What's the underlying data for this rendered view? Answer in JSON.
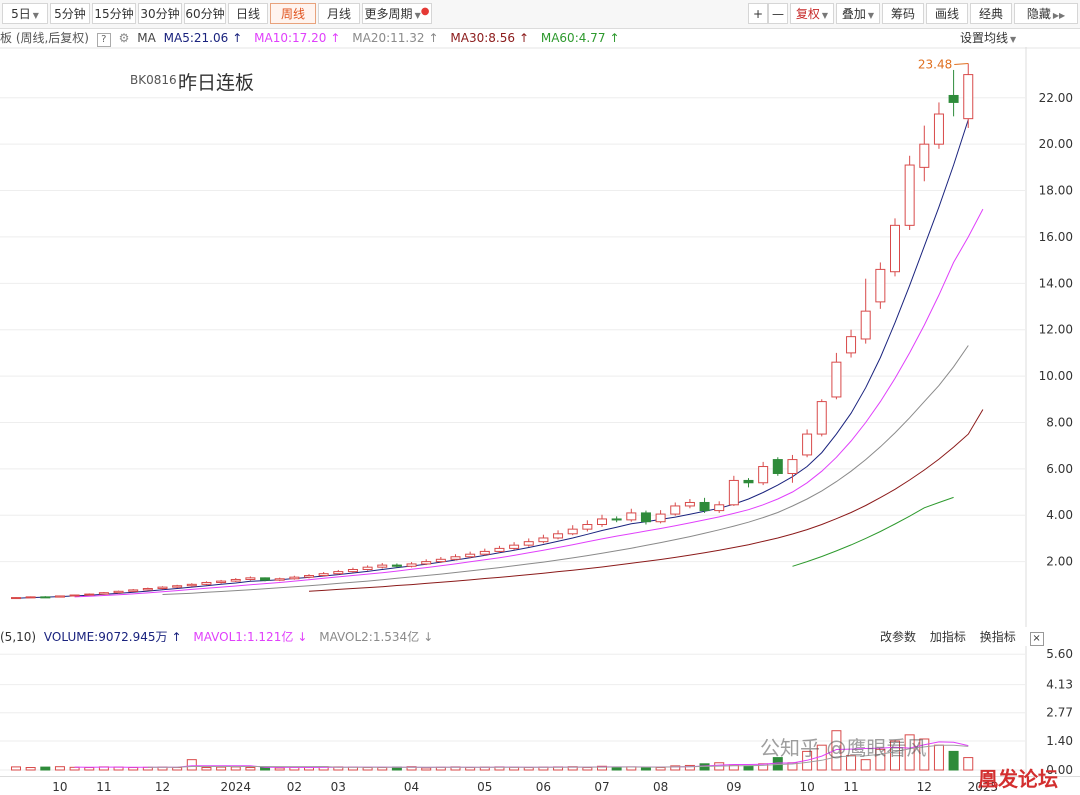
{
  "toolbar": {
    "periods": [
      "5日",
      "5分钟",
      "15分钟",
      "30分钟",
      "60分钟",
      "日线",
      "周线",
      "月线",
      "更多周期"
    ],
    "active_period": "周线",
    "plus": "+",
    "minus": "—",
    "fuquan": "复权",
    "overlay": "叠加",
    "chips": "筹码",
    "draw": "画线",
    "classic": "经典",
    "hide": "隐藏"
  },
  "ma_legend": {
    "prefix": "板 (周线,后复权)",
    "help": "?",
    "ma_label": "MA",
    "items": [
      {
        "text": "MA5:21.06",
        "arrow": "↑",
        "color": "#1a237e"
      },
      {
        "text": "MA10:17.20",
        "arrow": "↑",
        "color": "#e040fb"
      },
      {
        "text": "MA20:11.32",
        "arrow": "↑",
        "color": "#8a8a8a"
      },
      {
        "text": "MA30:8.56",
        "arrow": "↑",
        "color": "#8b1a1a"
      },
      {
        "text": "MA60:4.77",
        "arrow": "↑",
        "color": "#2e9a2e"
      }
    ],
    "settings": "设置均线"
  },
  "chart_title": {
    "code": "BK0816",
    "name": "昨日连板"
  },
  "volume_legend": {
    "prefix": "(5,10)",
    "volume": "VOLUME:9072.945万",
    "volume_arrow": "↑",
    "mavol1": "MAVOL1:1.121亿",
    "mavol1_arrow": "↓",
    "mavol2": "MAVOL2:1.534亿",
    "mavol2_arrow": "↓",
    "tools": [
      "改参数",
      "加指标",
      "换指标"
    ],
    "close": "×"
  },
  "watermark": {
    "text1": "公知乎 @鹰眼看风",
    "text2": "凰发论坛"
  },
  "chart_data": {
    "type": "candlestick",
    "period": "weekly",
    "max_label": "23.48",
    "price_axis": {
      "ticks": [
        2.0,
        4.0,
        6.0,
        8.0,
        10.0,
        12.0,
        14.0,
        16.0,
        18.0,
        20.0,
        22.0
      ],
      "ylim": [
        0,
        23.5
      ]
    },
    "volume_axis": {
      "ticks": [
        "5.60",
        "4.13",
        "2.77",
        "1.40",
        "0.00"
      ],
      "ylim": [
        0,
        5.9
      ]
    },
    "time_labels": [
      "10",
      "11",
      "12",
      "2024",
      "02",
      "03",
      "04",
      "05",
      "06",
      "07",
      "08",
      "09",
      "10",
      "11",
      "12",
      "2025"
    ],
    "colors": {
      "up": "#d84a4a",
      "down": "#2e8b3a"
    },
    "candles": [
      {
        "o": 0.42,
        "c": 0.45,
        "h": 0.47,
        "l": 0.4
      },
      {
        "o": 0.45,
        "c": 0.48,
        "h": 0.5,
        "l": 0.43
      },
      {
        "o": 0.48,
        "c": 0.47,
        "h": 0.51,
        "l": 0.45
      },
      {
        "o": 0.47,
        "c": 0.52,
        "h": 0.54,
        "l": 0.46
      },
      {
        "o": 0.52,
        "c": 0.56,
        "h": 0.58,
        "l": 0.5
      },
      {
        "o": 0.56,
        "c": 0.6,
        "h": 0.63,
        "l": 0.54
      },
      {
        "o": 0.6,
        "c": 0.66,
        "h": 0.69,
        "l": 0.58
      },
      {
        "o": 0.66,
        "c": 0.72,
        "h": 0.75,
        "l": 0.63
      },
      {
        "o": 0.72,
        "c": 0.78,
        "h": 0.82,
        "l": 0.7
      },
      {
        "o": 0.78,
        "c": 0.84,
        "h": 0.88,
        "l": 0.75
      },
      {
        "o": 0.84,
        "c": 0.9,
        "h": 0.94,
        "l": 0.8
      },
      {
        "o": 0.9,
        "c": 0.96,
        "h": 1.0,
        "l": 0.86
      },
      {
        "o": 0.96,
        "c": 1.02,
        "h": 1.07,
        "l": 0.92
      },
      {
        "o": 1.02,
        "c": 1.1,
        "h": 1.15,
        "l": 0.98
      },
      {
        "o": 1.1,
        "c": 1.16,
        "h": 1.21,
        "l": 1.05
      },
      {
        "o": 1.16,
        "c": 1.23,
        "h": 1.29,
        "l": 1.12
      },
      {
        "o": 1.23,
        "c": 1.3,
        "h": 1.36,
        "l": 1.18
      },
      {
        "o": 1.3,
        "c": 1.2,
        "h": 1.32,
        "l": 1.15
      },
      {
        "o": 1.2,
        "c": 1.26,
        "h": 1.31,
        "l": 1.16
      },
      {
        "o": 1.26,
        "c": 1.33,
        "h": 1.39,
        "l": 1.22
      },
      {
        "o": 1.33,
        "c": 1.4,
        "h": 1.46,
        "l": 1.28
      },
      {
        "o": 1.4,
        "c": 1.48,
        "h": 1.55,
        "l": 1.35
      },
      {
        "o": 1.48,
        "c": 1.57,
        "h": 1.64,
        "l": 1.44
      },
      {
        "o": 1.57,
        "c": 1.66,
        "h": 1.74,
        "l": 1.52
      },
      {
        "o": 1.66,
        "c": 1.76,
        "h": 1.84,
        "l": 1.61
      },
      {
        "o": 1.76,
        "c": 1.85,
        "h": 1.94,
        "l": 1.7
      },
      {
        "o": 1.85,
        "c": 1.8,
        "h": 1.92,
        "l": 1.74
      },
      {
        "o": 1.8,
        "c": 1.9,
        "h": 1.98,
        "l": 1.75
      },
      {
        "o": 1.9,
        "c": 2.0,
        "h": 2.1,
        "l": 1.85
      },
      {
        "o": 2.0,
        "c": 2.1,
        "h": 2.2,
        "l": 1.94
      },
      {
        "o": 2.1,
        "c": 2.21,
        "h": 2.32,
        "l": 2.05
      },
      {
        "o": 2.21,
        "c": 2.32,
        "h": 2.43,
        "l": 2.15
      },
      {
        "o": 2.32,
        "c": 2.44,
        "h": 2.56,
        "l": 2.26
      },
      {
        "o": 2.44,
        "c": 2.57,
        "h": 2.68,
        "l": 2.38
      },
      {
        "o": 2.57,
        "c": 2.71,
        "h": 2.84,
        "l": 2.5
      },
      {
        "o": 2.71,
        "c": 2.86,
        "h": 3.0,
        "l": 2.64
      },
      {
        "o": 2.86,
        "c": 3.02,
        "h": 3.16,
        "l": 2.79
      },
      {
        "o": 3.02,
        "c": 3.2,
        "h": 3.35,
        "l": 2.96
      },
      {
        "o": 3.2,
        "c": 3.4,
        "h": 3.57,
        "l": 3.14
      },
      {
        "o": 3.4,
        "c": 3.6,
        "h": 3.78,
        "l": 3.3
      },
      {
        "o": 3.6,
        "c": 3.84,
        "h": 4.02,
        "l": 3.5
      },
      {
        "o": 3.84,
        "c": 3.8,
        "h": 3.95,
        "l": 3.7
      },
      {
        "o": 3.8,
        "c": 4.1,
        "h": 4.28,
        "l": 3.72
      },
      {
        "o": 4.1,
        "c": 3.72,
        "h": 4.2,
        "l": 3.6
      },
      {
        "o": 3.72,
        "c": 4.05,
        "h": 4.22,
        "l": 3.65
      },
      {
        "o": 4.05,
        "c": 4.4,
        "h": 4.55,
        "l": 3.98
      },
      {
        "o": 4.4,
        "c": 4.55,
        "h": 4.7,
        "l": 4.3
      },
      {
        "o": 4.55,
        "c": 4.2,
        "h": 4.75,
        "l": 4.1
      },
      {
        "o": 4.2,
        "c": 4.45,
        "h": 4.6,
        "l": 4.1
      },
      {
        "o": 4.45,
        "c": 5.5,
        "h": 5.7,
        "l": 4.4
      },
      {
        "o": 5.5,
        "c": 5.4,
        "h": 5.6,
        "l": 5.2
      },
      {
        "o": 5.4,
        "c": 6.1,
        "h": 6.3,
        "l": 5.3
      },
      {
        "o": 6.4,
        "c": 5.8,
        "h": 6.5,
        "l": 5.7
      },
      {
        "o": 5.8,
        "c": 6.4,
        "h": 6.6,
        "l": 5.4
      },
      {
        "o": 6.6,
        "c": 7.5,
        "h": 7.7,
        "l": 6.5
      },
      {
        "o": 7.5,
        "c": 8.9,
        "h": 9.0,
        "l": 7.4
      },
      {
        "o": 9.1,
        "c": 10.6,
        "h": 11.0,
        "l": 9.0
      },
      {
        "o": 11.0,
        "c": 11.7,
        "h": 12.0,
        "l": 10.8
      },
      {
        "o": 11.6,
        "c": 12.8,
        "h": 14.2,
        "l": 11.4
      },
      {
        "o": 13.2,
        "c": 14.6,
        "h": 14.9,
        "l": 12.9
      },
      {
        "o": 14.5,
        "c": 16.5,
        "h": 16.8,
        "l": 14.3
      },
      {
        "o": 16.5,
        "c": 19.1,
        "h": 19.5,
        "l": 16.3
      },
      {
        "o": 19.0,
        "c": 20.0,
        "h": 20.8,
        "l": 18.4
      },
      {
        "o": 20.0,
        "c": 21.3,
        "h": 21.8,
        "l": 19.8
      },
      {
        "o": 22.1,
        "c": 21.8,
        "h": 23.2,
        "l": 21.2
      },
      {
        "o": 21.1,
        "c": 23.0,
        "h": 23.48,
        "l": 20.7
      }
    ],
    "ma_series": [
      {
        "name": "MA5",
        "color": "#1a237e",
        "start": 0,
        "values": [
          0.42,
          0.45,
          0.47,
          0.49,
          0.52,
          0.55,
          0.59,
          0.63,
          0.68,
          0.73,
          0.79,
          0.84,
          0.9,
          0.96,
          1.02,
          1.08,
          1.15,
          1.18,
          1.22,
          1.27,
          1.32,
          1.38,
          1.44,
          1.51,
          1.58,
          1.66,
          1.74,
          1.81,
          1.89,
          1.98,
          2.07,
          2.17,
          2.27,
          2.38,
          2.49,
          2.61,
          2.74,
          2.88,
          3.02,
          3.18,
          3.34,
          3.48,
          3.63,
          3.72,
          3.82,
          3.92,
          4.04,
          4.17,
          4.3,
          4.48,
          4.7,
          4.98,
          5.3,
          5.66,
          6.1,
          6.7,
          7.5,
          8.4,
          9.5,
          10.8,
          12.3,
          13.9,
          15.6,
          17.3,
          19.1,
          21.06
        ]
      },
      {
        "name": "MA10",
        "color": "#e040fb",
        "start": 4,
        "values": [
          0.48,
          0.51,
          0.54,
          0.57,
          0.61,
          0.65,
          0.7,
          0.75,
          0.8,
          0.85,
          0.9,
          0.95,
          1.0,
          1.05,
          1.1,
          1.16,
          1.22,
          1.28,
          1.34,
          1.4,
          1.46,
          1.52,
          1.59,
          1.67,
          1.74,
          1.82,
          1.9,
          1.99,
          2.08,
          2.17,
          2.27,
          2.38,
          2.49,
          2.61,
          2.73,
          2.86,
          2.98,
          3.1,
          3.21,
          3.32,
          3.43,
          3.55,
          3.67,
          3.8,
          3.93,
          4.08,
          4.24,
          4.45,
          4.7,
          5.0,
          5.4,
          5.9,
          6.5,
          7.2,
          8.0,
          8.9,
          9.9,
          11.0,
          12.2,
          13.5,
          14.9,
          16.0,
          17.2
        ]
      },
      {
        "name": "MA20",
        "color": "#8a8a8a",
        "start": 10,
        "values": [
          0.58,
          0.61,
          0.64,
          0.68,
          0.71,
          0.75,
          0.79,
          0.83,
          0.87,
          0.92,
          0.96,
          1.01,
          1.06,
          1.11,
          1.16,
          1.22,
          1.28,
          1.34,
          1.4,
          1.46,
          1.53,
          1.6,
          1.67,
          1.74,
          1.82,
          1.9,
          1.98,
          2.07,
          2.16,
          2.26,
          2.36,
          2.47,
          2.58,
          2.7,
          2.82,
          2.95,
          3.08,
          3.22,
          3.37,
          3.53,
          3.7,
          3.9,
          4.12,
          4.4,
          4.7,
          5.05,
          5.45,
          5.9,
          6.4,
          6.95,
          7.55,
          8.2,
          8.9,
          9.6,
          10.4,
          11.32
        ]
      },
      {
        "name": "MA30",
        "color": "#8b1a1a",
        "start": 20,
        "values": [
          0.72,
          0.76,
          0.8,
          0.84,
          0.88,
          0.92,
          0.97,
          1.01,
          1.06,
          1.11,
          1.16,
          1.21,
          1.27,
          1.32,
          1.38,
          1.44,
          1.5,
          1.57,
          1.63,
          1.7,
          1.77,
          1.85,
          1.93,
          2.01,
          2.09,
          2.18,
          2.28,
          2.38,
          2.49,
          2.61,
          2.73,
          2.87,
          3.02,
          3.19,
          3.38,
          3.6,
          3.85,
          4.12,
          4.42,
          4.76,
          5.12,
          5.52,
          5.95,
          6.42,
          6.94,
          7.5,
          8.56
        ]
      },
      {
        "name": "MA60",
        "color": "#2e9a2e",
        "start": 53,
        "values": [
          1.8,
          2.0,
          2.22,
          2.46,
          2.72,
          3.0,
          3.3,
          3.62,
          3.96,
          4.32,
          4.55,
          4.77
        ]
      }
    ],
    "volume": {
      "mavol_colors": [
        "#e040fb",
        "#a0a0a0"
      ],
      "values": [
        0.15,
        0.12,
        0.14,
        0.16,
        0.13,
        0.12,
        0.15,
        0.14,
        0.12,
        0.13,
        0.14,
        0.12,
        0.5,
        0.12,
        0.14,
        0.15,
        0.12,
        0.13,
        0.1,
        0.13,
        0.12,
        0.16,
        0.15,
        0.14,
        0.12,
        0.12,
        0.14,
        0.16,
        0.1,
        0.13,
        0.15,
        0.12,
        0.14,
        0.15,
        0.13,
        0.12,
        0.14,
        0.15,
        0.16,
        0.12,
        0.18,
        0.14,
        0.15,
        0.13,
        0.12,
        0.2,
        0.22,
        0.3,
        0.35,
        0.25,
        0.2,
        0.3,
        0.6,
        0.35,
        0.9,
        1.2,
        1.9,
        0.7,
        0.5,
        1.0,
        1.4,
        1.7,
        1.5,
        1.2,
        0.9,
        0.6
      ]
    }
  }
}
